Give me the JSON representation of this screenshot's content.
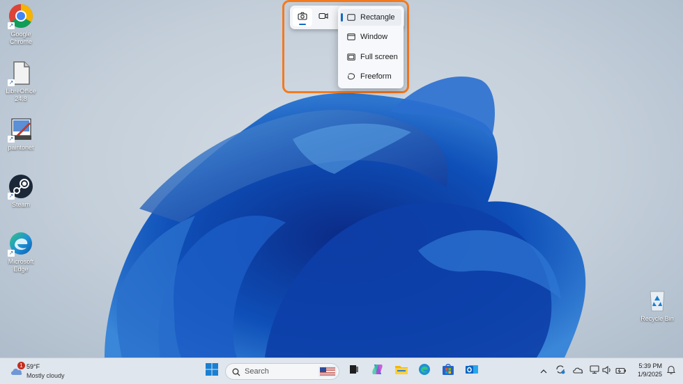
{
  "desktop": {
    "icons": [
      {
        "label": "Google Chrome",
        "icon": "chrome-icon"
      },
      {
        "label": "LibreOffice 24.8",
        "icon": "libreoffice-icon"
      },
      {
        "label": "paintonet",
        "icon": "paintdotnet-icon"
      },
      {
        "label": "Steam",
        "icon": "steam-icon"
      },
      {
        "label": "Microsoft Edge",
        "icon": "edge-icon"
      }
    ],
    "recycle_bin": {
      "label": "Recycle Bin",
      "icon": "recycle-bin-icon"
    }
  },
  "snip": {
    "modes": [
      {
        "name": "screenshot-mode",
        "icon": "camera-icon",
        "selected": true
      },
      {
        "name": "record-mode",
        "icon": "video-camera-icon",
        "selected": false
      }
    ],
    "menu": [
      {
        "label": "Rectangle",
        "icon": "rectangle-icon",
        "selected": true
      },
      {
        "label": "Window",
        "icon": "window-icon",
        "selected": false
      },
      {
        "label": "Full screen",
        "icon": "fullscreen-icon",
        "selected": false
      },
      {
        "label": "Freeform",
        "icon": "freeform-icon",
        "selected": false
      }
    ],
    "highlight_color": "#f47a1f"
  },
  "taskbar": {
    "weather": {
      "temp": "59°F",
      "condition": "Mostly cloudy",
      "badge": "1"
    },
    "search": {
      "placeholder": "Search"
    },
    "clock": {
      "time": "5:39 PM",
      "date": "1/9/2025"
    }
  }
}
